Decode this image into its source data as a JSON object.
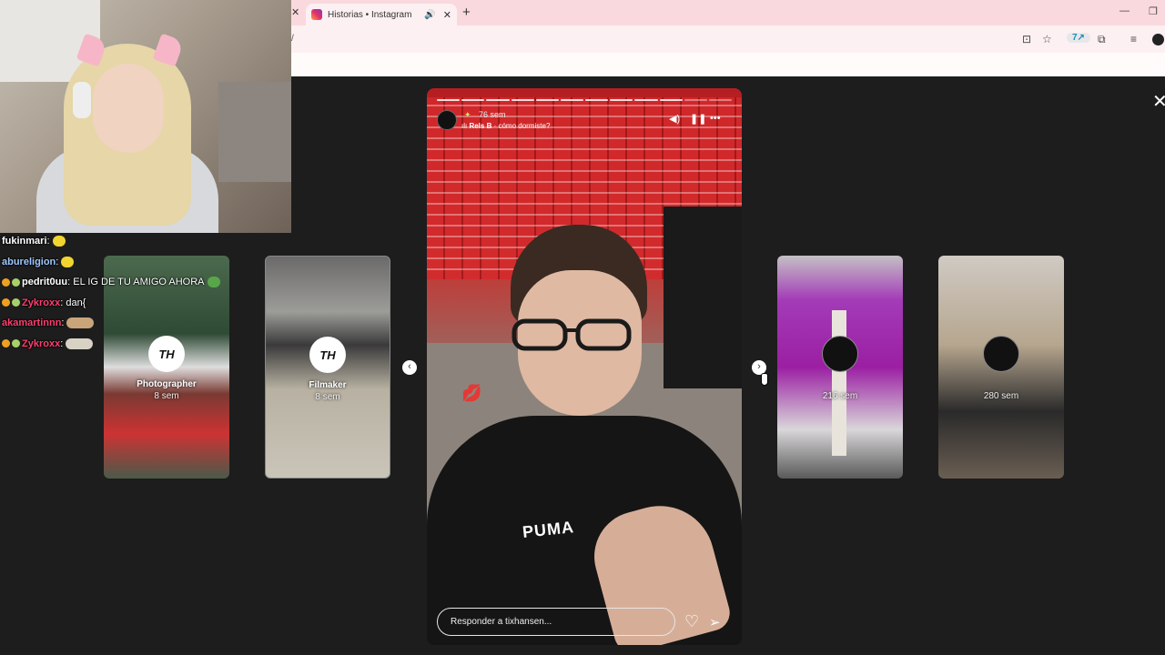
{
  "browser": {
    "tab_title": "Historias • Instagram",
    "tab_speaker": "🔊",
    "tab_close": "✕",
    "prev_tab_close": "✕",
    "new_tab": "+",
    "minimize": "—",
    "restore": "❐",
    "address_fragment": "/",
    "icons": [
      "install-icon",
      "star-icon",
      "extension-app-icon",
      "puzzle-icon",
      "media-icon",
      "profile-icon"
    ]
  },
  "chat": {
    "messages": [
      {
        "user": "fukinmari",
        "separator": ":",
        "text": "",
        "color": "#ffffff",
        "badges": false
      },
      {
        "user": "abureligion",
        "separator": ":",
        "text": "",
        "color": "#9fc7ff",
        "badges": false
      },
      {
        "user": "pedrit0uu",
        "separator": ":",
        "text": "EL IG DE TU AMIGO AHORA",
        "color": "#ffffff",
        "badges": true
      },
      {
        "user": "Zykroxx",
        "separator": ":",
        "text": "dan{",
        "color": "#ff3d6e",
        "badges": true
      },
      {
        "user": "akamartinnn",
        "separator": ":",
        "text": "",
        "color": "#ff3d6e",
        "badges": false
      },
      {
        "user": "Zykroxx",
        "separator": ":",
        "text": "",
        "color": "#ff3d6e",
        "badges": true
      }
    ]
  },
  "stories": {
    "left": [
      {
        "name": "Photographer",
        "time": "8 sem",
        "avatar_text": "TH"
      },
      {
        "name": "Filmaker",
        "time": "8 sem",
        "avatar_text": "TH"
      }
    ],
    "right": [
      {
        "name": "",
        "time": "216 sem"
      },
      {
        "name": "",
        "time": "280 sem"
      }
    ],
    "prev_label": "‹",
    "next_label": "›",
    "close_label": "✕"
  },
  "current_story": {
    "time": "76 sem",
    "music_prefix": "Rels B",
    "music_title": "· cómo dormiste?",
    "sparkle": "✦",
    "reply_placeholder": "Responder a tixhansen...",
    "logo_text": "PUMA",
    "progress_segments": 12,
    "progress_filled": 10,
    "lips_emoji": "💋"
  },
  "colors": {
    "page_bg": "#1d1d1d",
    "tabbar": "#f9d9de",
    "chat_user_default": "#ffffff"
  }
}
